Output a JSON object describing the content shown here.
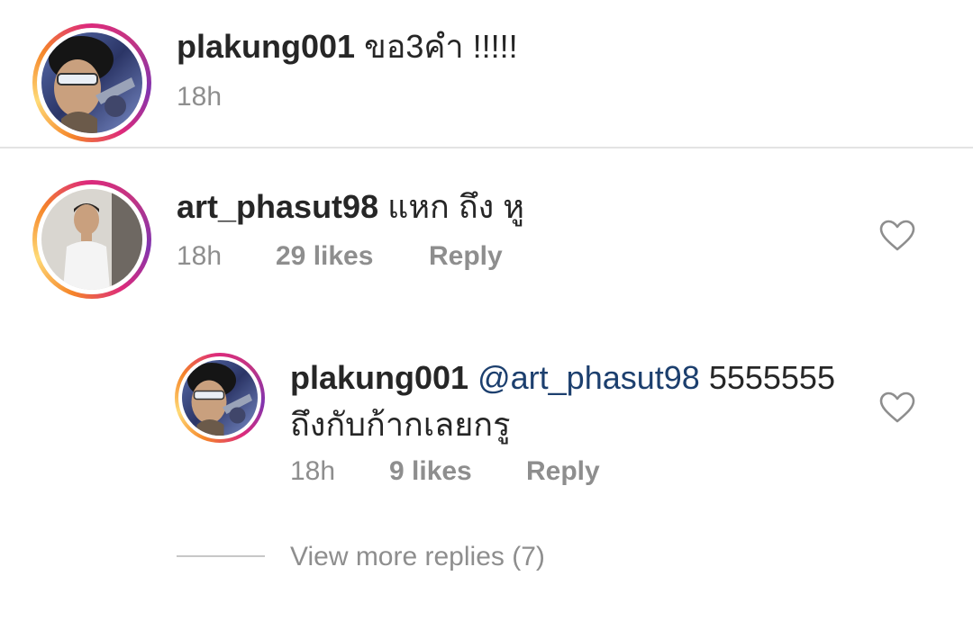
{
  "comments": [
    {
      "username": "plakung001",
      "text": "ขอ3คำ !!!!!",
      "time": "18h"
    },
    {
      "username": "art_phasut98",
      "text": "แหก ถึง หู",
      "time": "18h",
      "likes": "29 likes",
      "reply_label": "Reply"
    }
  ],
  "reply": {
    "username": "plakung001",
    "mention": "@art_phasut98",
    "text_line1": "5555555",
    "text_line2": "ถึงกับก้ากเลยกรู",
    "time": "18h",
    "likes": "9 likes",
    "reply_label": "Reply"
  },
  "view_more_replies": "View more replies (7)",
  "icons": {
    "like": "heart-outline-icon"
  },
  "colors": {
    "text": "#262626",
    "secondary": "#8e8e8e",
    "mention": "#1c3f6e",
    "divider": "#e3e3e3"
  }
}
